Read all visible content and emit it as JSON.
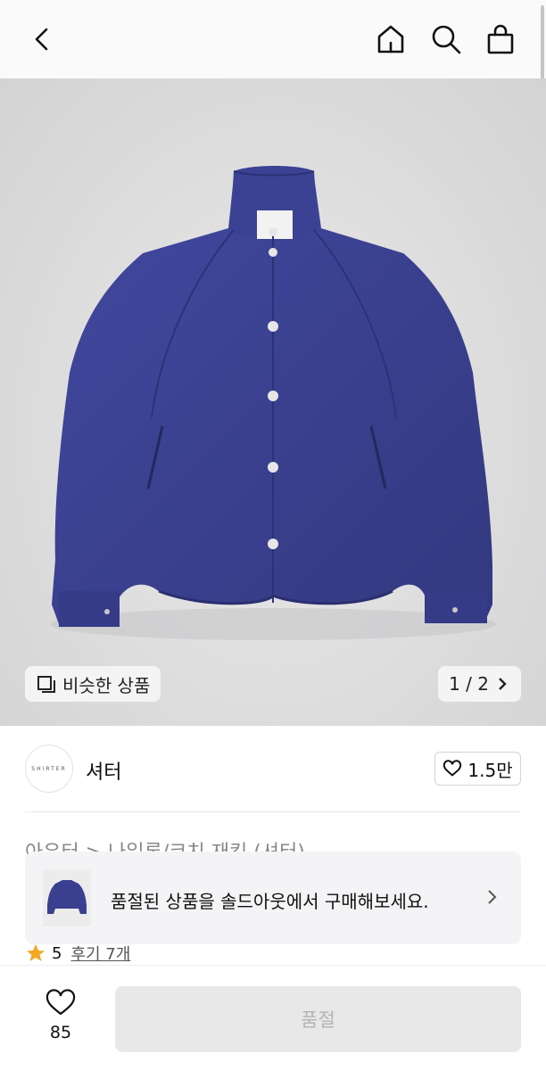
{
  "header": {
    "icons": [
      "chevron-left-icon",
      "home-icon",
      "search-icon",
      "bag-icon"
    ]
  },
  "gallery": {
    "similar_label": "비슷한 상품",
    "page_indicator": "1 / 2",
    "jacket_color": "#3a3f8f"
  },
  "brand": {
    "logo_text": "SHIRTER",
    "name": "셔터",
    "likes": "1.5만"
  },
  "category": {
    "breadcrumb": "아우터 > 나일론/코치 재킷 (셔터)"
  },
  "banner": {
    "text": "품절된 상품을 솔드아웃에서 구매해보세요."
  },
  "rating": {
    "score": "5",
    "reviews": "후기 7개",
    "star_color": "#f5a623"
  },
  "bottom_bar": {
    "wish_count": "85",
    "buy_label": "품절"
  }
}
